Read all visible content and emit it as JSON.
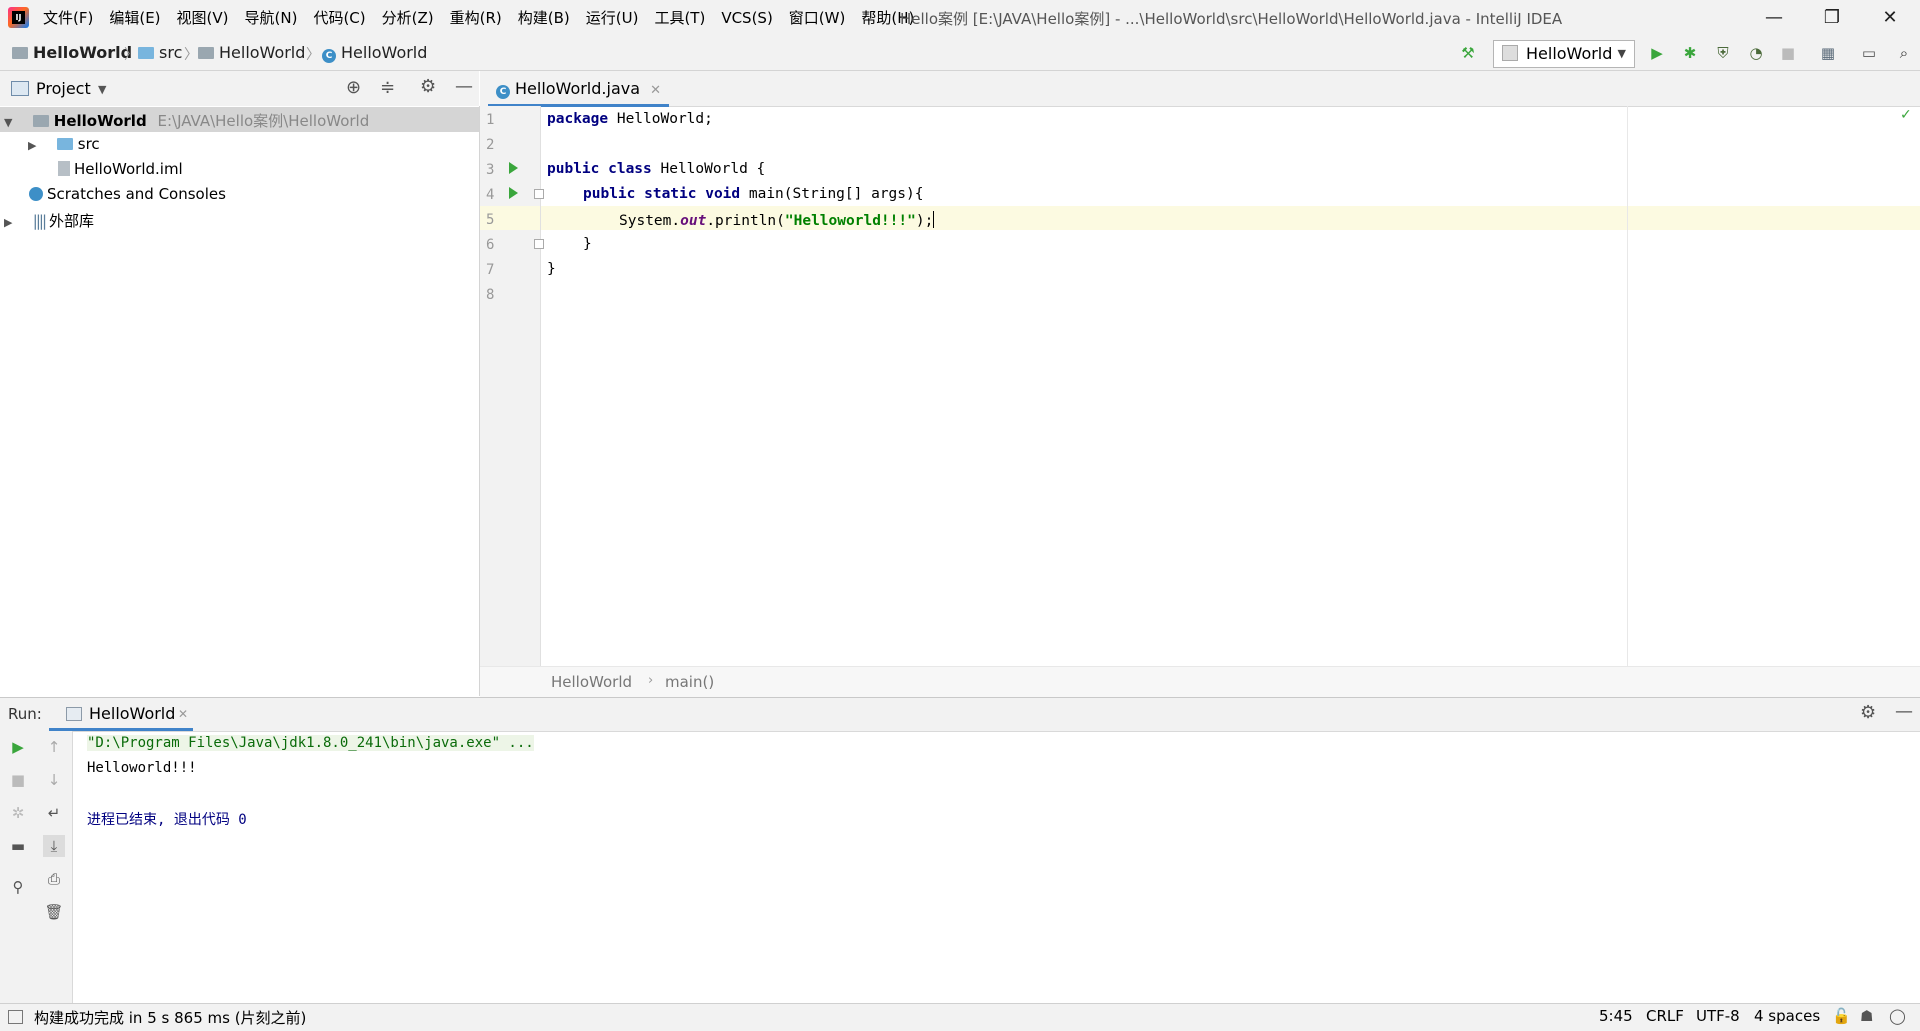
{
  "window": {
    "title": "Hello案例 [E:\\JAVA\\Hello案例] - ...\\HelloWorld\\src\\HelloWorld\\HelloWorld.java - IntelliJ IDEA",
    "logo_text": "IJ",
    "minimize": "—",
    "restore": "❐",
    "close": "✕"
  },
  "menu": [
    "文件(F)",
    "编辑(E)",
    "视图(V)",
    "导航(N)",
    "代码(C)",
    "分析(Z)",
    "重构(R)",
    "构建(B)",
    "运行(U)",
    "工具(T)",
    "VCS(S)",
    "窗口(W)",
    "帮助(H)"
  ],
  "navbar": {
    "crumbs": [
      "HelloWorld",
      "src",
      "HelloWorld",
      "HelloWorld"
    ],
    "run_config": "HelloWorld"
  },
  "project_panel": {
    "title": "Project",
    "tree": [
      {
        "label": "HelloWorld",
        "path": "E:\\JAVA\\Hello案例\\HelloWorld"
      },
      {
        "label": "src"
      },
      {
        "label": "HelloWorld.iml"
      },
      {
        "label": "Scratches and Consoles"
      },
      {
        "label": "外部库"
      }
    ]
  },
  "editor": {
    "tab": "HelloWorld.java",
    "line_numbers": [
      "1",
      "2",
      "3",
      "4",
      "5",
      "6",
      "7",
      "8"
    ],
    "lines": {
      "l1_kw": "package",
      "l1_rest": " HelloWorld;",
      "l3_kw": "public class",
      "l3_rest": " HelloWorld {",
      "l4_kw": "public static void",
      "l4_rest": " main(String[] args){",
      "l5_a": "System.",
      "l5_field": "out",
      "l5_b": ".println(",
      "l5_str": "\"Helloworld!!!\"",
      "l5_c": ");",
      "l6": "}",
      "l7": "}"
    },
    "breadcrumb": [
      "HelloWorld",
      "main()"
    ]
  },
  "run_panel": {
    "label": "Run:",
    "tab": "HelloWorld",
    "output": [
      {
        "text": "\"D:\\Program Files\\Java\\jdk1.8.0_241\\bin\\java.exe\" ...",
        "color": "#0a6b0a"
      },
      {
        "text": "Helloworld!!!",
        "color": "#000000"
      },
      {
        "text": "进程已结束, 退出代码 0",
        "color": "#000080"
      }
    ]
  },
  "status": {
    "message": "构建成功完成 in 5 s 865 ms (片刻之前)",
    "position": "5:45",
    "line_sep": "CRLF",
    "encoding": "UTF-8",
    "indent": "4 spaces"
  },
  "colors": {
    "accent": "#4083c9",
    "run_green": "#3aa63c",
    "keyword": "#000080",
    "string": "#008000"
  }
}
